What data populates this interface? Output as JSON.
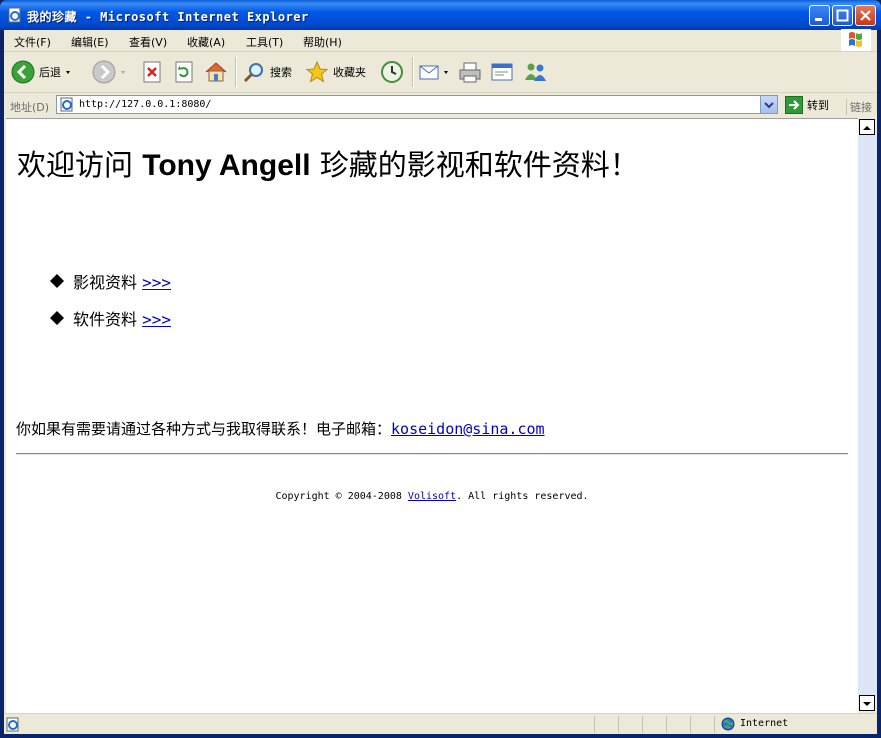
{
  "window": {
    "title": "我的珍藏 - Microsoft Internet Explorer"
  },
  "menu": [
    "文件(F)",
    "编辑(E)",
    "查看(V)",
    "收藏(A)",
    "工具(T)",
    "帮助(H)"
  ],
  "toolbar": {
    "back_label": "后退",
    "search_label": "搜索",
    "favorites_label": "收藏夹"
  },
  "address": {
    "label": "地址(D)",
    "url": "http://127.0.0.1:8080/",
    "go_label": "转到",
    "links_label": "链接"
  },
  "page": {
    "heading_pre": "欢迎访问",
    "heading_name": "Tony Angell",
    "heading_post": "珍藏的影视和软件资料！",
    "items": [
      {
        "label": "影视资料",
        "link": ">>>"
      },
      {
        "label": "软件资料",
        "link": ">>>"
      }
    ],
    "contact_text": "你如果有需要请通过各种方式与我取得联系！电子邮箱：",
    "email": "koseidon@sina.com",
    "copyright_pre": "Copyright © 2004-2008",
    "copyright_link": "Volisoft",
    "copyright_post": ". All rights reserved."
  },
  "status": {
    "zone": "Internet"
  },
  "colors": {
    "titlebar": "#0058e6",
    "link": "#0000cc",
    "chrome": "#ece9d8"
  }
}
